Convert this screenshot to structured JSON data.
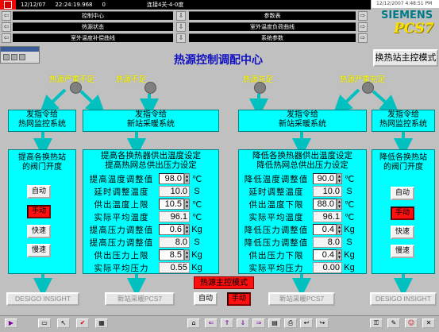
{
  "status_bar": {
    "date": "12/12/07",
    "time": "22:24:19.968",
    "value": "0",
    "connection": "连接4关-4-0度"
  },
  "clock_text": "12/12/2007 4:48:51 PM",
  "logo": {
    "brand": "SIEMENS",
    "product": "PCS7"
  },
  "nav": {
    "row1": [
      "控制中心",
      "参数表"
    ],
    "row2": [
      "热源状态",
      "室外温度负荷曲线"
    ],
    "row3": [
      "室外温度补偿曲线",
      "系统参数"
    ]
  },
  "title": "热源控制调配中心",
  "mode_button": "换热站主控模式",
  "yellow_labels": [
    "热源严重不足",
    "热源不足",
    "热源充足",
    "热源严重充足"
  ],
  "top_boxes": {
    "far_left": [
      "发指令给",
      "热网监控系统"
    ],
    "mid_left": [
      "发指令给",
      "新站采暖系统"
    ],
    "mid_right": [
      "发指令给",
      "新站采暖系统"
    ],
    "far_right": [
      "发指令给",
      "热网监控系统"
    ]
  },
  "left_panel": {
    "title": [
      "提高各换热站",
      "的阀门开度"
    ],
    "buttons": [
      "自动",
      "手动",
      "快速",
      "慢速"
    ]
  },
  "right_panel": {
    "title": [
      "降低各换热站",
      "的阀门开度"
    ],
    "buttons": [
      "自动",
      "手动",
      "快速",
      "慢速"
    ]
  },
  "left_table": {
    "header": [
      "提高各换热器供出温度设定",
      "提高热网总供出压力设定"
    ],
    "rows": [
      {
        "label": "提高温度调整值",
        "value": "98.0",
        "unit": "℃",
        "spin": true
      },
      {
        "label": "延时调整温度",
        "value": "10.0",
        "unit": "S",
        "spin": false
      },
      {
        "label": "供出温度上限",
        "value": "10.5",
        "unit": "℃",
        "spin": true
      },
      {
        "label": "实际平均温度",
        "value": "96.1",
        "unit": "℃",
        "spin": false
      },
      {
        "label": "提高压力调整值",
        "value": "0.6",
        "unit": "Kg",
        "spin": true
      },
      {
        "label": "提高压力调整值",
        "value": "8.0",
        "unit": "S",
        "spin": false
      },
      {
        "label": "供出压力上限",
        "value": "8.5",
        "unit": "Kg",
        "spin": true
      },
      {
        "label": "实际平均压力",
        "value": "0.55",
        "unit": "Kg",
        "spin": false
      }
    ]
  },
  "right_table": {
    "header": [
      "降低各换热器供出温度设定",
      "降低热网总供出压力设定"
    ],
    "rows": [
      {
        "label": "降低温度调整值",
        "value": "90.0",
        "unit": "℃",
        "spin": true
      },
      {
        "label": "延时调整温度",
        "value": "10.0",
        "unit": "S",
        "spin": false
      },
      {
        "label": "供出温度下限",
        "value": "88.0",
        "unit": "℃",
        "spin": true
      },
      {
        "label": "实际平均温度",
        "value": "96.1",
        "unit": "℃",
        "spin": false
      },
      {
        "label": "降低压力调整值",
        "value": "0.4",
        "unit": "Kg",
        "spin": true
      },
      {
        "label": "降低压力调整值",
        "value": "8.0",
        "unit": "S",
        "spin": false
      },
      {
        "label": "供出压力下限",
        "value": "0.4",
        "unit": "Kg",
        "spin": true
      },
      {
        "label": "实际平均压力",
        "value": "0.00",
        "unit": "Kg",
        "spin": false
      }
    ]
  },
  "center": {
    "label": "热源主控模式",
    "auto": "自动",
    "manual": "手动"
  },
  "bottom_buttons": [
    "DESIGO INSIGHT",
    "新站采暖PCS7",
    "新站采暖PCS7",
    "DESIGO INSIGHT"
  ],
  "colors": {
    "cyan": "#00ffff",
    "red": "#ff1010",
    "yellow": "#ffff00",
    "title_blue": "#1010c0"
  }
}
